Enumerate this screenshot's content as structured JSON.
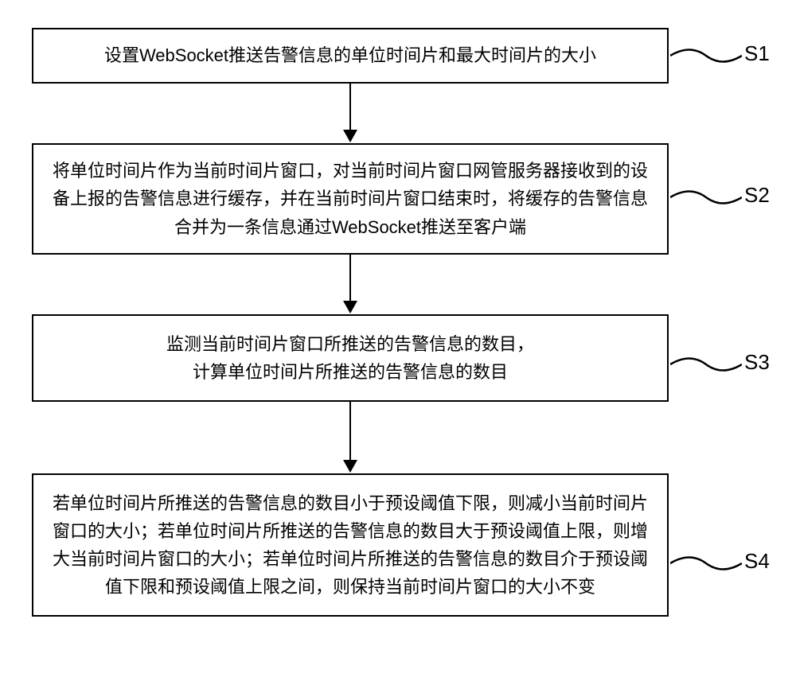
{
  "flowchart": {
    "steps": [
      {
        "id": "S1",
        "text": "设置WebSocket推送告警信息的单位时间片和最大时间片的大小"
      },
      {
        "id": "S2",
        "text": "将单位时间片作为当前时间片窗口，对当前时间片窗口网管服务器接收到的设备上报的告警信息进行缓存，并在当前时间片窗口结束时，将缓存的告警信息合并为一条信息通过WebSocket推送至客户端"
      },
      {
        "id": "S3",
        "text": "监测当前时间片窗口所推送的告警信息的数目，\n计算单位时间片所推送的告警信息的数目"
      },
      {
        "id": "S4",
        "text": "若单位时间片所推送的告警信息的数目小于预设阈值下限，则减小当前时间片窗口的大小；若单位时间片所推送的告警信息的数目大于预设阈值上限，则增大当前时间片窗口的大小；若单位时间片所推送的告警信息的数目介于预设阈值下限和预设阈值上限之间，则保持当前时间片窗口的大小不变"
      }
    ],
    "labels": {
      "s1": "S1",
      "s2": "S2",
      "s3": "S3",
      "s4": "S4"
    }
  }
}
